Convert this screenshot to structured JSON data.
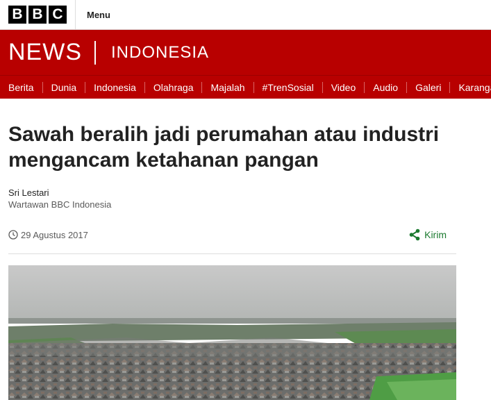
{
  "brand": {
    "letters": [
      "B",
      "B",
      "C"
    ],
    "menu_label": "Menu"
  },
  "masthead": {
    "news": "NEWS",
    "edition": "INDONESIA"
  },
  "nav": {
    "items": [
      "Berita",
      "Dunia",
      "Indonesia",
      "Olahraga",
      "Majalah",
      "#TrenSosial",
      "Video",
      "Audio",
      "Galeri",
      "Karangan"
    ]
  },
  "article": {
    "headline": "Sawah beralih jadi perumahan atau industri mengancam ketahanan pangan",
    "author_name": "Sri Lestari",
    "author_role": "Wartawan BBC Indonesia",
    "date": "29 Agustus 2017",
    "share_label": "Kirim"
  },
  "colors": {
    "brand_red": "#b80000",
    "share_green": "#1b7a2f"
  },
  "icons": {
    "date": "clock-icon",
    "share": "share-icon"
  }
}
